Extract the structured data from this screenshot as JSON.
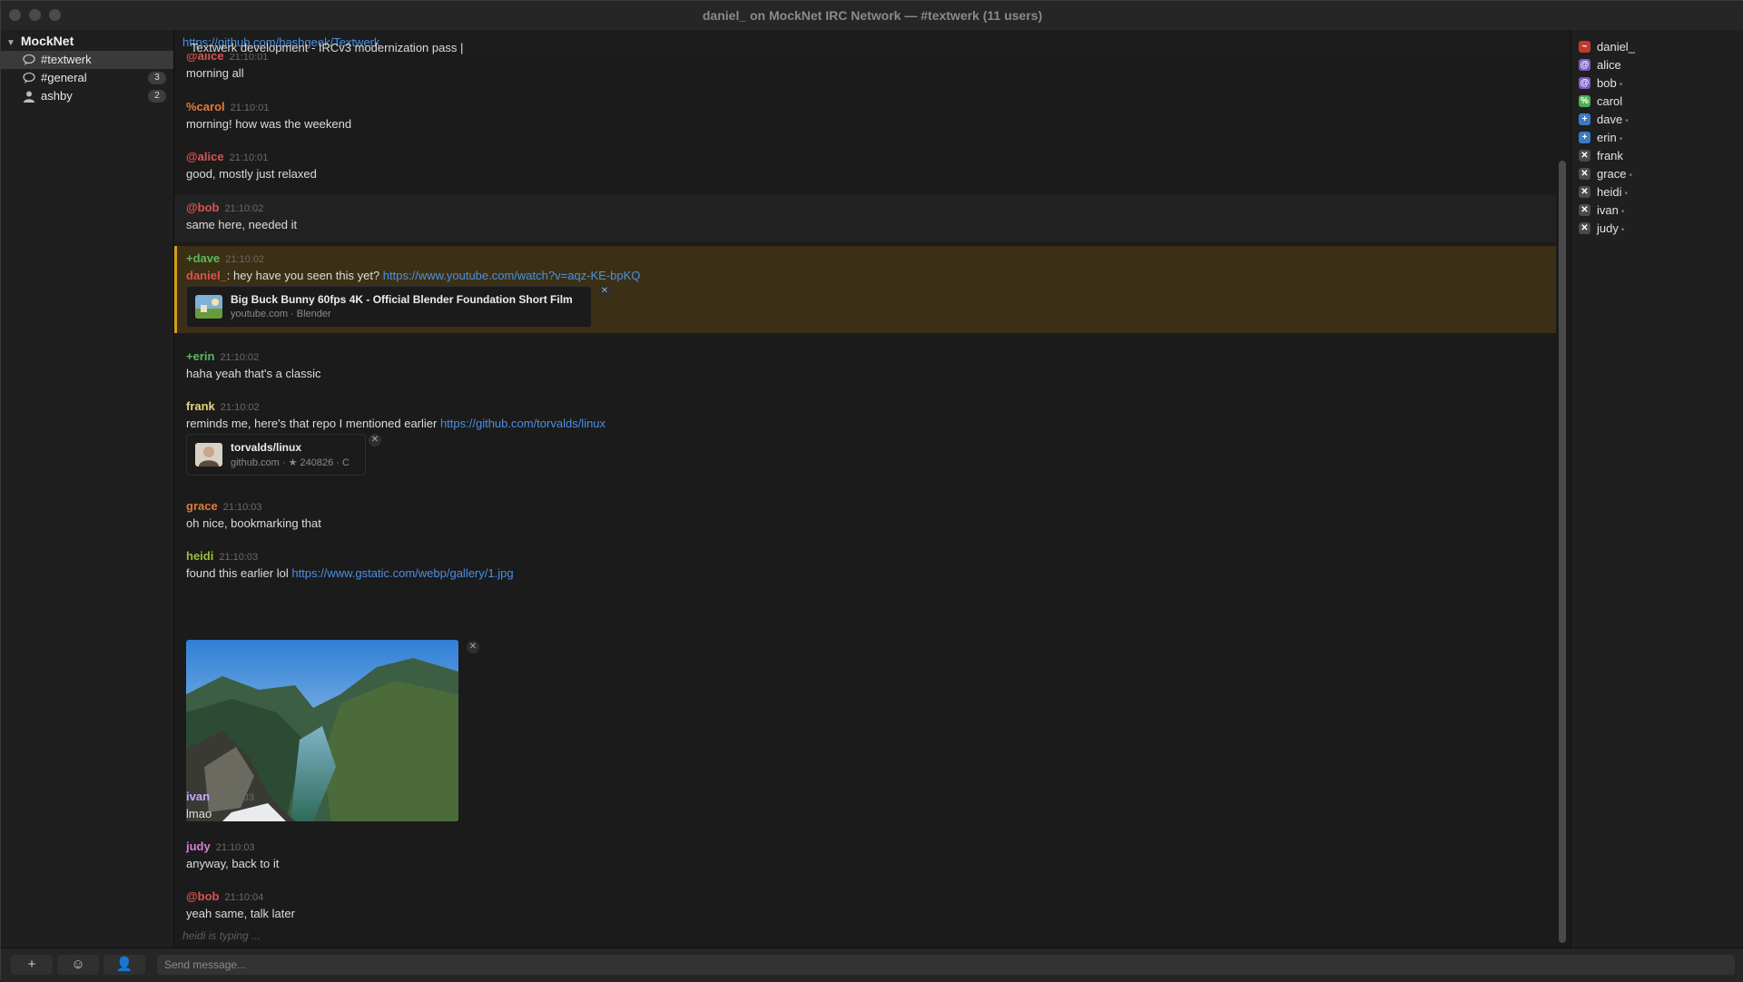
{
  "window": {
    "title": "daniel_ on MockNet IRC Network — #textwerk (11 users)"
  },
  "sidebar": {
    "network": "MockNet",
    "channels": [
      {
        "label": "#textwerk",
        "badge": "",
        "icon": "chat-icon"
      },
      {
        "label": "#general",
        "badge": "3",
        "icon": "chat-icon"
      },
      {
        "label": "ashby",
        "badge": "2",
        "icon": "person-icon"
      }
    ]
  },
  "topic": {
    "text": "Textwerk development - IRCv3 modernization pass | ",
    "link": "https://github.com/bashgeek/Textwerk"
  },
  "messages": [
    {
      "nick": "@alice",
      "time": "21:10:01",
      "text": "morning all",
      "color": "#d9534f"
    },
    {
      "nick": "%carol",
      "time": "21:10:01",
      "text": "morning! how was the weekend",
      "color": "#e07b39"
    },
    {
      "nick": "@alice",
      "time": "21:10:01",
      "text": "good, mostly just relaxed",
      "color": "#d9534f"
    },
    {
      "nick": "@bob",
      "time": "21:10:02",
      "text": "same here, needed it",
      "color": "#d9534f"
    },
    {
      "nick": "+dave",
      "time": "21:10:02",
      "mention": "daniel_",
      "text": ": hey have you seen this yet? ",
      "link": "https://www.youtube.com/watch?v=aqz-KE-bpKQ",
      "color": "#5cb85c",
      "mention_color": "#d9534f",
      "card": {
        "title": "Big Buck Bunny 60fps 4K - Official Blender Foundation Short Film",
        "subtitle": "youtube.com · Blender",
        "thumb": "video-thumbnail"
      }
    },
    {
      "nick": "+erin",
      "time": "21:10:02",
      "text": "haha yeah that's a classic",
      "color": "#5cb85c"
    },
    {
      "nick": "frank",
      "time": "21:10:02",
      "text": "reminds me, here's that repo I mentioned earlier ",
      "link": "https://github.com/torvalds/linux",
      "color": "#e8d47a",
      "card": {
        "title": "torvalds/linux",
        "subtitle": "github.com · ★ 240826 · C",
        "thumb": "avatar-thumbnail"
      }
    },
    {
      "nick": "grace",
      "time": "21:10:03",
      "text": "oh nice, bookmarking that",
      "color": "#e07b39"
    },
    {
      "nick": "heidi",
      "time": "21:10:03",
      "text": "found this earlier lol ",
      "link": "https://www.gstatic.com/webp/gallery/1.jpg",
      "color": "#9bbf3a"
    },
    {
      "nick": "ivan",
      "time": "21:10:03",
      "text": "lmao",
      "color": "#c7a6ff"
    },
    {
      "nick": "judy",
      "time": "21:10:03",
      "text": "anyway, back to it",
      "color": "#d77fd1"
    },
    {
      "nick": "@bob",
      "time": "21:10:04",
      "text": "yeah same, talk later",
      "color": "#d9534f"
    }
  ],
  "typing": "heidi is typing ...",
  "users": [
    {
      "name": "daniel_",
      "mode": "~",
      "color": "#c0392b",
      "away": false
    },
    {
      "name": "alice",
      "mode": "@",
      "color": "#7a5bc7",
      "away": false
    },
    {
      "name": "bob",
      "mode": "@",
      "color": "#7a5bc7",
      "away": true
    },
    {
      "name": "carol",
      "mode": "%",
      "color": "#4caf50",
      "away": false
    },
    {
      "name": "dave",
      "mode": "+",
      "color": "#3a7bc8",
      "away": true
    },
    {
      "name": "erin",
      "mode": "+",
      "color": "#3a7bc8",
      "away": true
    },
    {
      "name": "frank",
      "mode": "✕",
      "color": "#4a4a4a",
      "away": false
    },
    {
      "name": "grace",
      "mode": "✕",
      "color": "#4a4a4a",
      "away": true
    },
    {
      "name": "heidi",
      "mode": "✕",
      "color": "#4a4a4a",
      "away": true
    },
    {
      "name": "ivan",
      "mode": "✕",
      "color": "#4a4a4a",
      "away": true
    },
    {
      "name": "judy",
      "mode": "✕",
      "color": "#4a4a4a",
      "away": true
    }
  ],
  "away_mark": "•",
  "bottom": {
    "add_label": "+",
    "emoji_label": "☺",
    "user_label": "👤",
    "input_placeholder": "Send message..."
  }
}
